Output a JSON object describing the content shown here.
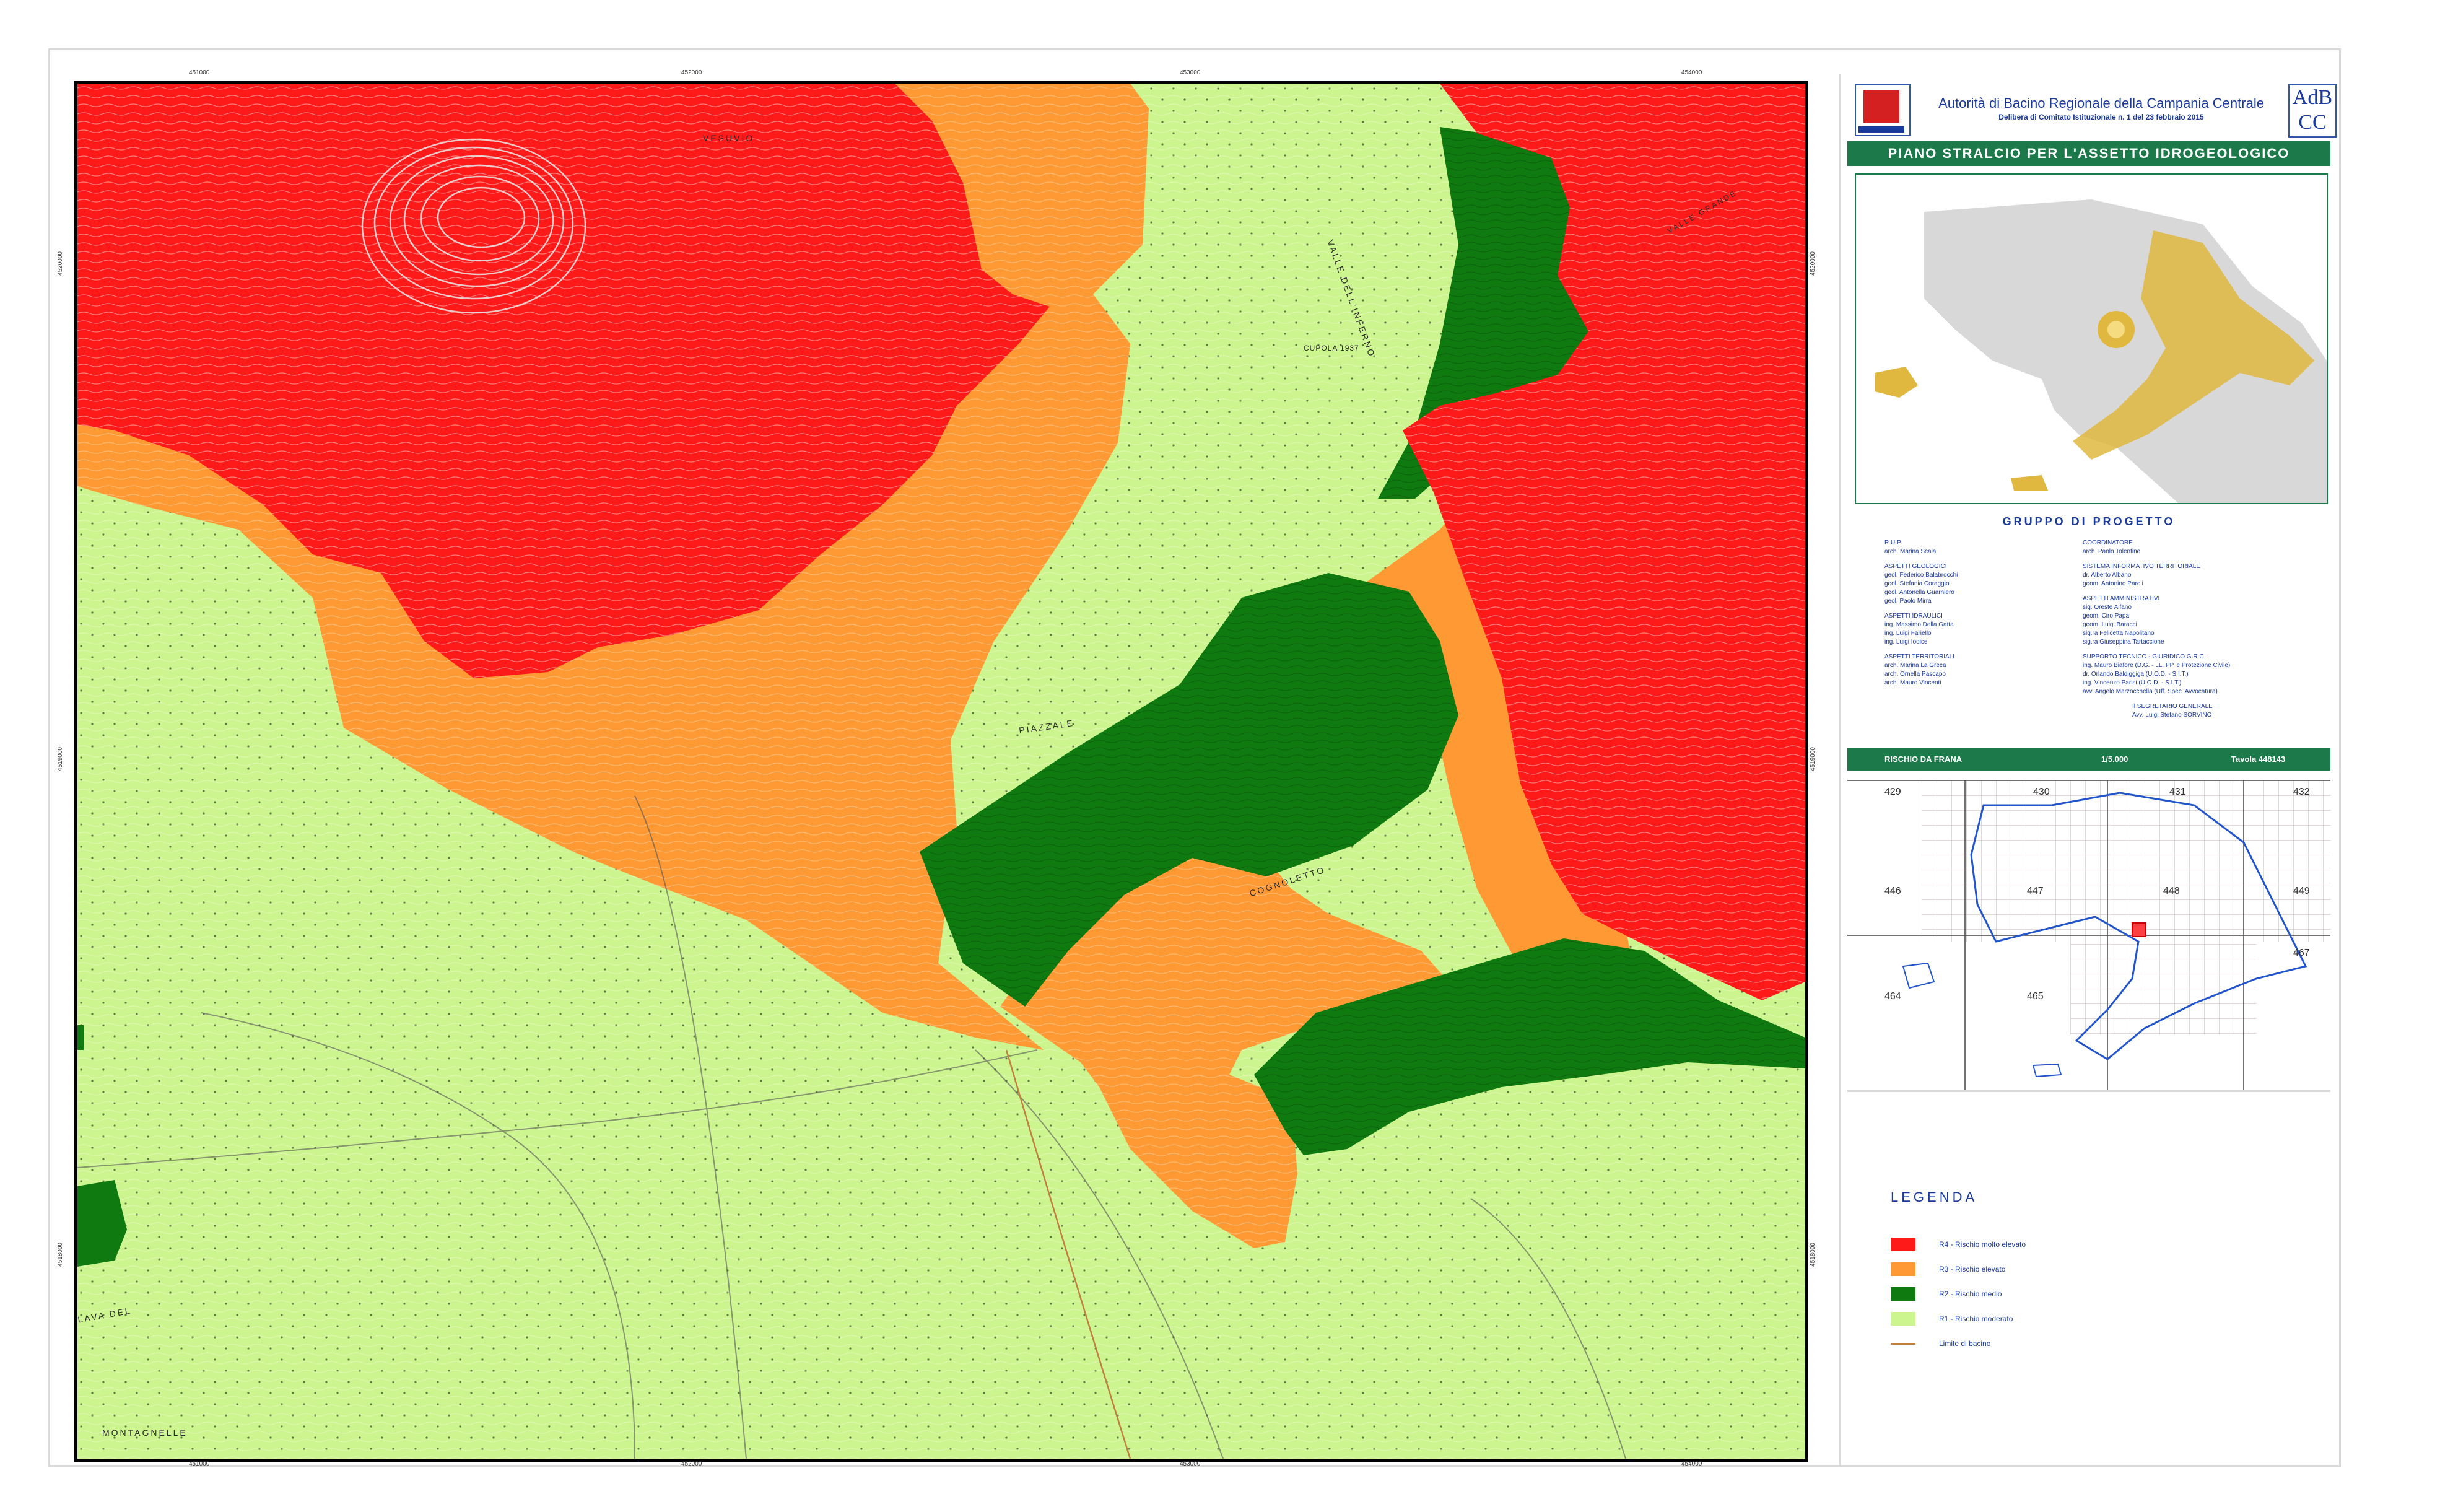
{
  "map": {
    "labels": {
      "vesuvio": "VESUVIO",
      "piazzale": "PIAZZALE",
      "cognoletto": "COGNOLETTO",
      "cupola": "CUPOLA 1937",
      "lava_del": "LAVA DEL",
      "montagnelle": "MONTAGNELLE",
      "valle_dell_inferno": "VALLE DELL'INFERNO",
      "valle_grande": "VALLE GRANDE"
    },
    "coords_top": [
      "451000",
      "452000",
      "453000",
      "454000"
    ],
    "coords_bottom": [
      "451000",
      "452000",
      "453000",
      "454000"
    ],
    "coords_left": [
      "4520000",
      "4519000",
      "4518000"
    ],
    "coords_right": [
      "4520000",
      "4519000",
      "4518000"
    ]
  },
  "header": {
    "authority": "Autorità di Bacino Regionale della Campania Centrale",
    "delibera": "Delibera di Comitato Istituzionale n. 1 del 23 febbraio 2015",
    "title": "PIANO STRALCIO PER L'ASSETTO IDROGEOLOGICO",
    "logo_right": "AdB",
    "logo_right_sub": "CC"
  },
  "credits": {
    "title": "GRUPPO DI PROGETTO",
    "left": [
      {
        "h": "R.U.P.",
        "l": [
          "arch. Marina Scala"
        ]
      },
      {
        "h": "ASPETTI GEOLOGICI",
        "l": [
          "geol. Federico Balabrocchi",
          "geol. Stefania Coraggio",
          "geol. Antonella Guarniero",
          "geol. Paolo Mirra"
        ]
      },
      {
        "h": "ASPETTI IDRAULICI",
        "l": [
          "ing. Massimo Della Gatta",
          "ing. Luigi Fariello",
          "ing. Luigi Iodice"
        ]
      },
      {
        "h": "ASPETTI TERRITORIALI",
        "l": [
          "arch. Marina La Greca",
          "arch. Ornella Pascapo",
          "arch. Mauro Vincenti"
        ]
      }
    ],
    "right": [
      {
        "h": "COORDINATORE",
        "l": [
          "arch. Paolo Tolentino"
        ]
      },
      {
        "h": "SISTEMA INFORMATIVO TERRITORIALE",
        "l": [
          "dr. Alberto Albano",
          "geom. Antonino Paroli"
        ]
      },
      {
        "h": "ASPETTI AMMINISTRATIVI",
        "l": [
          "sig. Oreste Alfano",
          "geom. Ciro Papa",
          "geom. Luigi Baracci",
          "sig.ra Felicetta Napolitano",
          "sig.ra Giuseppina Tartaccione"
        ]
      },
      {
        "h": "SUPPORTO TECNICO - GIURIDICO G.R.C.",
        "l": [
          "ing. Mauro Biafore (D.G. - LL. PP. e Protezione Civile)",
          "dr. Orlando Baldiggiga (U.O.D. - S.I.T.)",
          "ing. Vincenzo Parisi (U.O.D. - S.I.T.)",
          "avv. Angelo Marzocchella (Uff. Spec. Avvocatura)"
        ]
      },
      {
        "h": "",
        "l": [
          "Il SEGRETARIO GENERALE",
          "Avv. Luigi Stefano SORVINO"
        ]
      }
    ]
  },
  "scale_bar": {
    "left": "RISCHIO DA FRANA",
    "mid": "1/5.000",
    "right": "Tavola 448143"
  },
  "index_map": {
    "sheets": [
      "429",
      "430",
      "431",
      "432",
      "446",
      "447",
      "448",
      "449",
      "464",
      "465",
      "467"
    ]
  },
  "legend": {
    "title": "LEGENDA",
    "items": [
      {
        "label": "R4 - Rischio molto elevato",
        "color": "#ff1a1a"
      },
      {
        "label": "R3 - Rischio elevato",
        "color": "#ff9933"
      },
      {
        "label": "R2 - Rischio medio",
        "color": "#0f7a0f"
      },
      {
        "label": "R1 - Rischio moderato",
        "color": "#cdf58f"
      },
      {
        "label": "Limite di bacino",
        "color": "#c08040"
      }
    ]
  },
  "colors": {
    "r4": "#ff1a1a",
    "r3": "#ff9933",
    "r2": "#0f7a0f",
    "r1": "#cdf58f",
    "header_green": "#1c7a4a",
    "accent_blue": "#1b3a9e"
  }
}
